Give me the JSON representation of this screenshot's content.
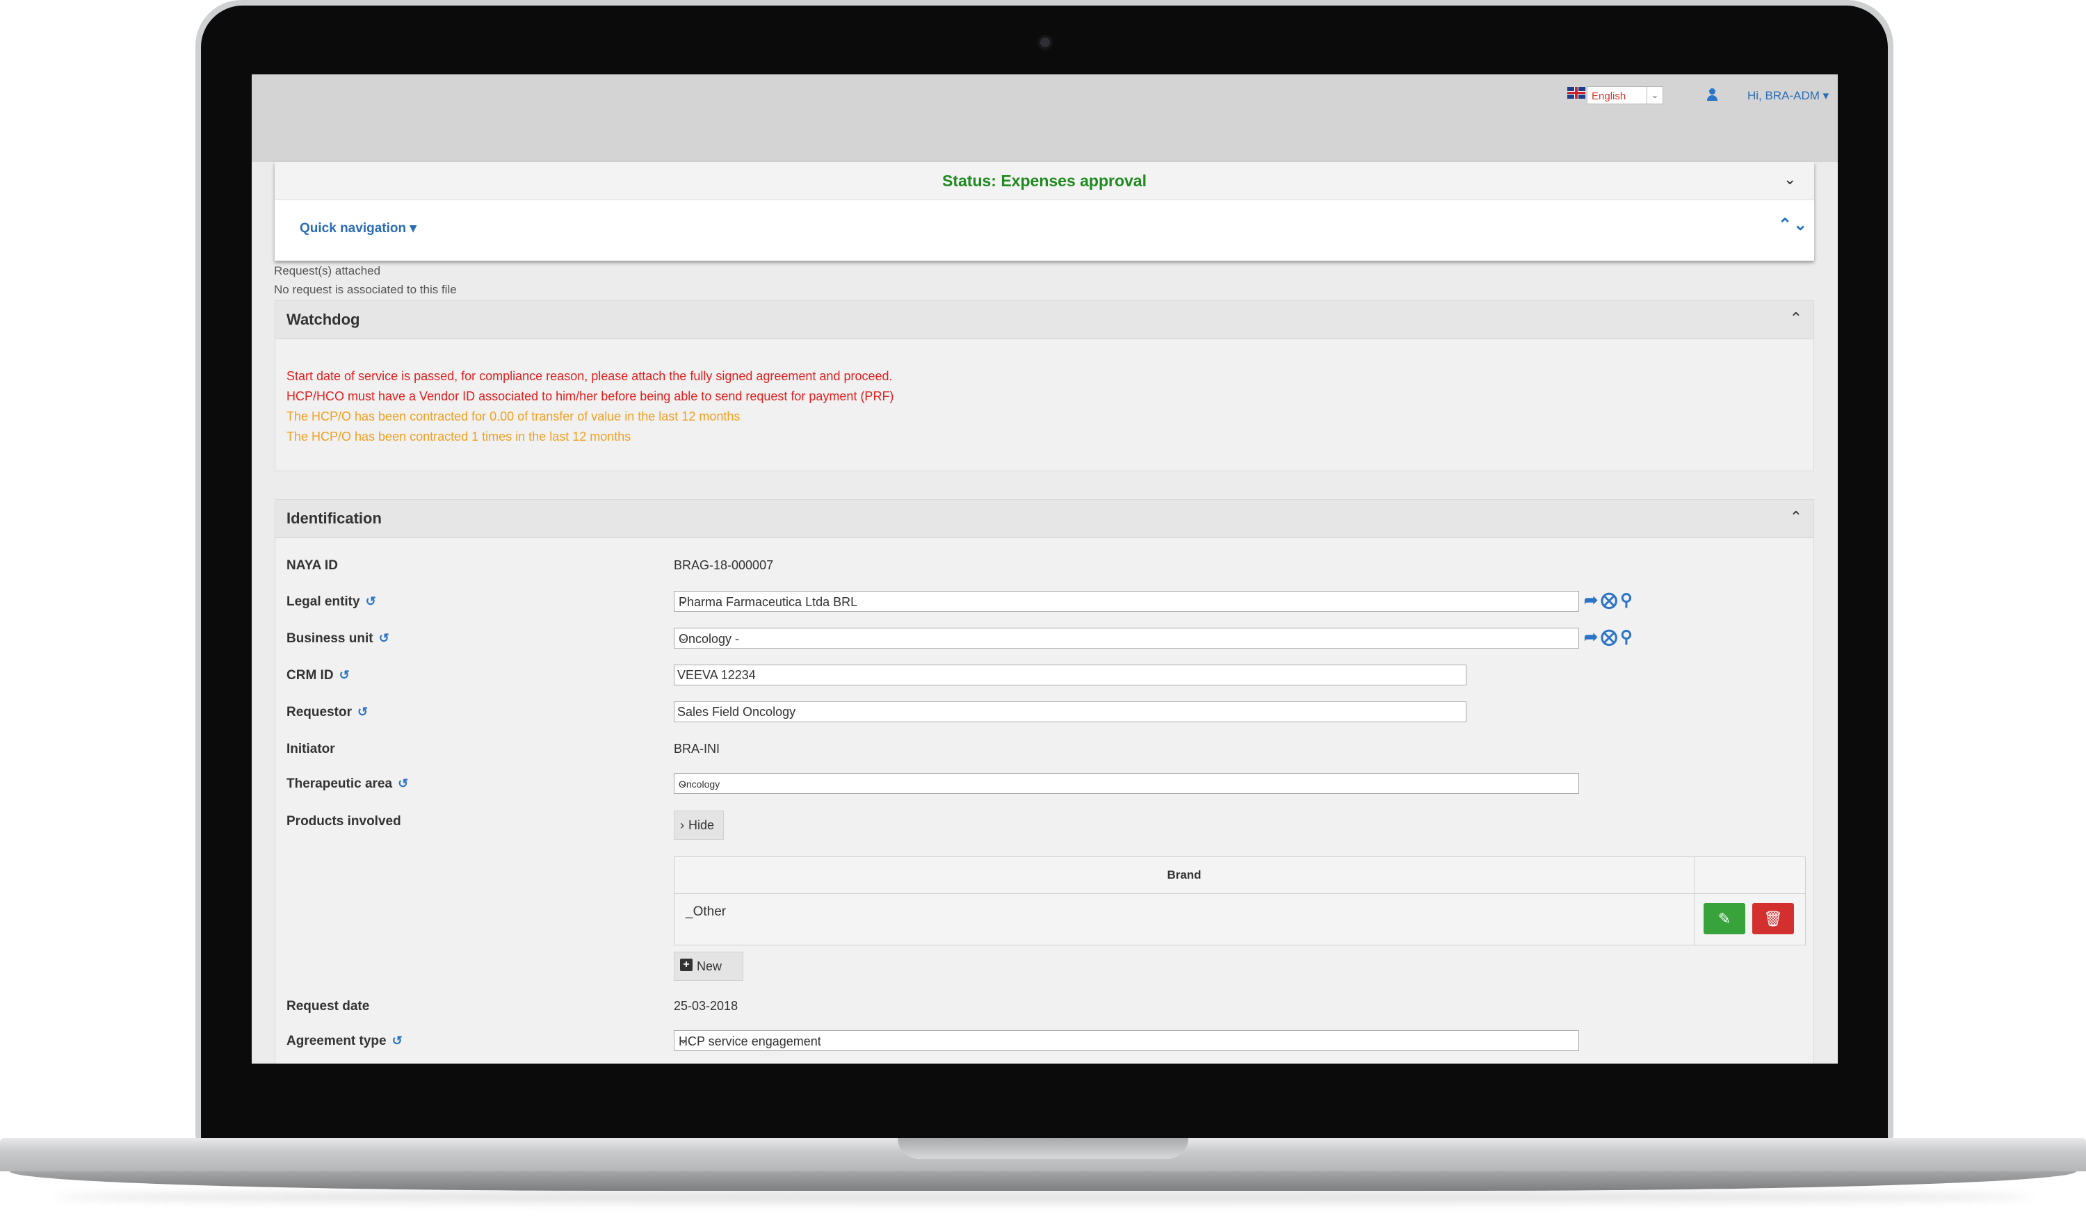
{
  "header": {
    "language": "English",
    "user_greeting": "Hi, BRA-ADM ▾"
  },
  "status": {
    "text": "Status: Expenses approval",
    "quick_navigation": "Quick navigation ▾"
  },
  "requests": {
    "title": "Request(s) attached",
    "empty_text": "No request is associated to this file"
  },
  "watchdog": {
    "title": "Watchdog",
    "messages": [
      {
        "text": "Start date of service is passed, for compliance reason, please attach the fully signed agreement and proceed.",
        "color": "#e02020"
      },
      {
        "text": "HCP/HCO must have a Vendor ID associated to him/her before being able to send request for payment (PRF)",
        "color": "#e02020"
      },
      {
        "text": "The HCP/O has been contracted for 0.00 of transfer of value in the last 12 months",
        "color": "#f0a020"
      },
      {
        "text": "The HCP/O has been contracted 1 times in the last 12 months",
        "color": "#f0a020"
      }
    ]
  },
  "identification": {
    "title": "Identification",
    "naya_id": {
      "label": "NAYA ID",
      "value": "BRAG-18-000007"
    },
    "legal_entity": {
      "label": "Legal entity",
      "value": "Pharma Farmaceutica Ltda BRL"
    },
    "business_unit": {
      "label": "Business unit",
      "value": "Oncology -"
    },
    "crm_id": {
      "label": "CRM ID",
      "value": "VEEVA 12234"
    },
    "requestor": {
      "label": "Requestor",
      "value": "Sales Field Oncology"
    },
    "initiator": {
      "label": "Initiator",
      "value": "BRA-INI"
    },
    "therapeutic_area": {
      "label": "Therapeutic area",
      "value": "Oncology"
    },
    "products_involved": {
      "label": "Products involved",
      "hide_button": "Hide",
      "column_header": "Brand",
      "rows": [
        "_Other"
      ],
      "new_button": "New"
    },
    "request_date": {
      "label": "Request date",
      "value": "25-03-2018"
    },
    "agreement_type": {
      "label": "Agreement type",
      "value": "HCP service engagement"
    }
  },
  "colors": {
    "status_green": "#1f8a1f",
    "link_blue": "#2b6cb5",
    "edit_green": "#37a33a",
    "delete_red": "#d32f2f"
  }
}
